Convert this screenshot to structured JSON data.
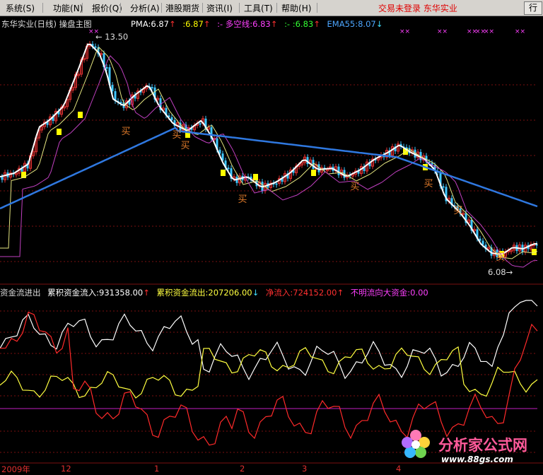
{
  "menu": {
    "items": [
      "系统",
      "功能",
      "报价",
      "分析",
      "港股期货",
      "资讯",
      "工具",
      "帮助"
    ],
    "shortcuts": [
      "(S)",
      "(N)",
      "(Q)",
      "(A)",
      "",
      "(I)",
      "(T)",
      "(H)"
    ],
    "status": "交易未登录  东华实业",
    "right_button": "行"
  },
  "main_panel": {
    "title": "东华实业(日线)",
    "subtitle": "操盘主图",
    "indicators": [
      {
        "label": "PMA:6.87",
        "arrow": "↑",
        "color": "#ffffff"
      },
      {
        "label": ":6.87",
        "arrow": "↑",
        "color": "#ffff00"
      },
      {
        "label": ":- 多空线:6.83",
        "arrow": "↑",
        "color": "#ff40ff"
      },
      {
        "label": ":- :6.83",
        "arrow": "↑",
        "color": "#33ff33"
      },
      {
        "label": "EMA55:8.07",
        "arrow": "↓",
        "color": "#4da6ff"
      }
    ],
    "high_label": "13.50",
    "low_label": "6.08",
    "buy_label": "买",
    "signal_mark": "××",
    "colors": {
      "up": "#e03030",
      "down": "#40c8ff",
      "ema": "#2f78e0",
      "fast": "#ffffff",
      "slow": "#e6e680",
      "mid": "#c040c0",
      "buy": "#e07a2a",
      "hi": "#ffff00"
    }
  },
  "sub_panel": {
    "title": "资金流进出",
    "indicators": [
      {
        "label": "累积资金流入:931358.00",
        "arrow": "↑",
        "color": "#ffffff"
      },
      {
        "label": "累积资金流出:207206.00",
        "arrow": "↓",
        "color": "#ffff40"
      },
      {
        "label": "净流入:724152.00",
        "arrow": "↑",
        "color": "#ff3030"
      },
      {
        "label": "不明流向大资金:0.00",
        "arrow": "",
        "color": "#ff40ff"
      }
    ]
  },
  "time_axis": {
    "labels": [
      "2009年",
      "12",
      "1",
      "2",
      "3",
      "4"
    ]
  },
  "watermark": {
    "text": "分析家公式网",
    "url": "www.88gs.com"
  }
}
